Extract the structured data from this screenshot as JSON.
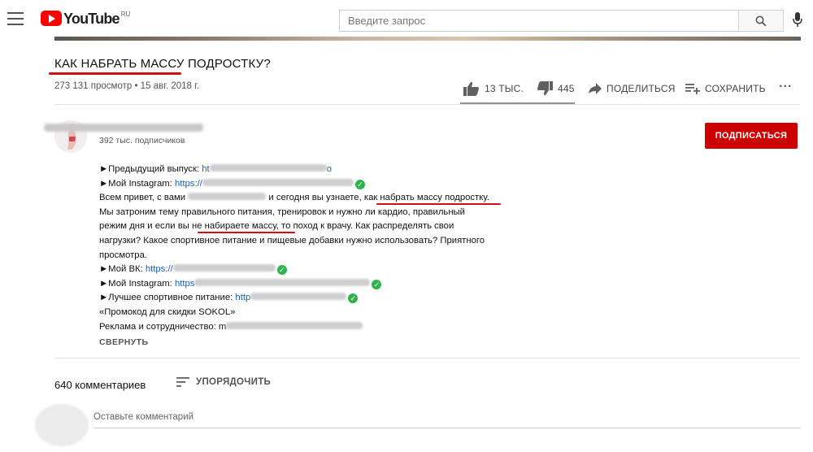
{
  "header": {
    "logo_text": "YouTube",
    "logo_region": "RU",
    "search_placeholder": "Введите запрос"
  },
  "video": {
    "title": "КАК НАБРАТЬ МАССУ ПОДРОСТКУ?",
    "views": "273 131 просмотр",
    "date": "15 авг. 2018 г.",
    "meta_sep": " • "
  },
  "actions": {
    "likes": "13 ТЫС.",
    "dislikes": "445",
    "share": "ПОДЕЛИТЬСЯ",
    "save": "СОХРАНИТЬ",
    "more": "···"
  },
  "channel": {
    "subscribers": "392 тыс. подписчиков",
    "subscribe_label": "ПОДПИСАТЬСЯ"
  },
  "description": {
    "l1_prefix": "►Предыдущий выпуск: ",
    "l1_link": "ht",
    "l1_link_tail": "o",
    "l2_prefix": "►Мой Instagram: ",
    "l2_link": "https://",
    "l3_a": "Всем привет, с вами ",
    "l3_b": " и сегодня вы узнаете, ",
    "l3_c": "как набрать массу подростку",
    "l3_d": ".",
    "l4": "Мы затроним тему правильного питания, тренировок и нужно ли кардио, правильный",
    "l5_a": "режим дня и если вы ",
    "l5_b": "не набираете массу",
    "l5_c": ", то поход к врачу. Как распределять свои",
    "l6": "нагрузки? Какое спортивное питание и пищевые добавки нужно использовать? Приятного",
    "l7": "просмотра.",
    "l8_prefix": "►Мой ВК: ",
    "l8_link": "https://",
    "l9_prefix": "►Мой Instagram: ",
    "l9_link": "https",
    "l10_prefix": "►Лучшее спортивное питание: ",
    "l10_link": "http",
    "l11": "«Промокод для скидки SOKOL»",
    "l12_prefix": "Реклама и сотрудничество: ",
    "l12_lead": "m",
    "collapse": "СВЕРНУТЬ"
  },
  "comments": {
    "count": "640 комментариев",
    "sort": "УПОРЯДОЧИТЬ",
    "placeholder": "Оставьте комментарий"
  },
  "colors": {
    "brand_red": "#ff0000",
    "subscribe_red": "#cc0000",
    "annotation_red": "#d40d14",
    "link_blue": "#1a5fb4",
    "verified_green": "#2fb34a"
  }
}
